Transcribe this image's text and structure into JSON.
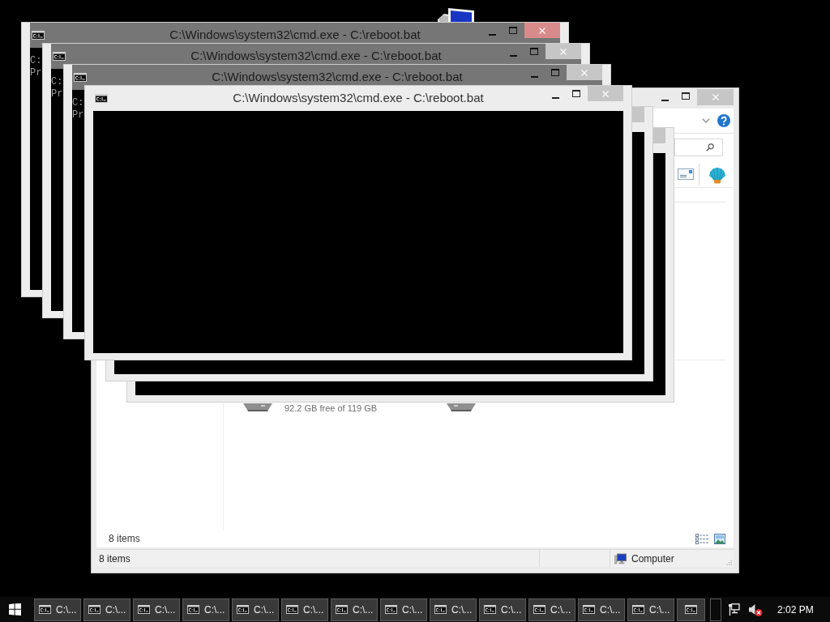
{
  "cmd_windows": [
    {
      "title": "C:\\Windows\\system32\\cmd.exe - C:\\reboot.bat",
      "dimmed": true,
      "controls": [
        {
          "kind": "minimize",
          "highlighted": false
        },
        {
          "kind": "maximize",
          "highlighted": false
        },
        {
          "kind": "close",
          "highlighted": true
        }
      ],
      "console_lines": [
        "C:",
        "Pr"
      ]
    },
    {
      "title": "C:\\Windows\\system32\\cmd.exe - C:\\reboot.bat",
      "dimmed": true,
      "controls": [
        {
          "kind": "minimize",
          "highlighted": false
        },
        {
          "kind": "maximize",
          "highlighted": false
        },
        {
          "kind": "close",
          "highlighted": false
        }
      ],
      "console_lines": [
        "C:",
        "Pr"
      ]
    },
    {
      "title": "C:\\Windows\\system32\\cmd.exe - C:\\reboot.bat",
      "dimmed": true,
      "controls": [
        {
          "kind": "minimize",
          "highlighted": false
        },
        {
          "kind": "maximize",
          "highlighted": false
        },
        {
          "kind": "close",
          "highlighted": false
        }
      ],
      "console_lines": [
        "C:",
        "Pr"
      ]
    },
    {
      "title": "C:\\Windows\\system32\\cmd.exe - C:\\reboot.bat",
      "dimmed": false,
      "controls": [
        {
          "kind": "minimize",
          "highlighted": false
        },
        {
          "kind": "maximize",
          "highlighted": false
        },
        {
          "kind": "close",
          "highlighted": false
        }
      ]
    },
    {
      "dimmed": false,
      "controls": [
        {
          "kind": "close",
          "highlighted": false
        }
      ]
    },
    {
      "dimmed": false,
      "controls": [
        {
          "kind": "close",
          "highlighted": false
        }
      ]
    }
  ],
  "explorer": {
    "controls": [
      {
        "kind": "minimize",
        "highlighted": false
      },
      {
        "kind": "maximize",
        "highlighted": false
      },
      {
        "kind": "close",
        "highlighted": false
      }
    ],
    "drive_caption": "92.2 GB free of 119 GB",
    "item_count": "8 items",
    "status_bar": {
      "item_count": "8 items",
      "location": "Computer"
    }
  },
  "taskbar": {
    "buttons": [
      {
        "kind": "wide",
        "label": "C:\\..."
      },
      {
        "kind": "wide",
        "label": "C:\\..."
      },
      {
        "kind": "wide",
        "label": "C:\\..."
      },
      {
        "kind": "wide",
        "label": "C:\\..."
      },
      {
        "kind": "wide",
        "label": "C:\\..."
      },
      {
        "kind": "wide",
        "label": "C:\\..."
      },
      {
        "kind": "wide",
        "label": "C:\\..."
      },
      {
        "kind": "wide",
        "label": "C:\\..."
      },
      {
        "kind": "wide",
        "label": "C:\\..."
      },
      {
        "kind": "wide",
        "label": "C:\\..."
      },
      {
        "kind": "wide",
        "label": "C:\\..."
      },
      {
        "kind": "wide",
        "label": "C:\\..."
      },
      {
        "kind": "wide",
        "label": "C:\\..."
      },
      {
        "kind": "narrow"
      }
    ],
    "clock": "2:02 PM"
  }
}
